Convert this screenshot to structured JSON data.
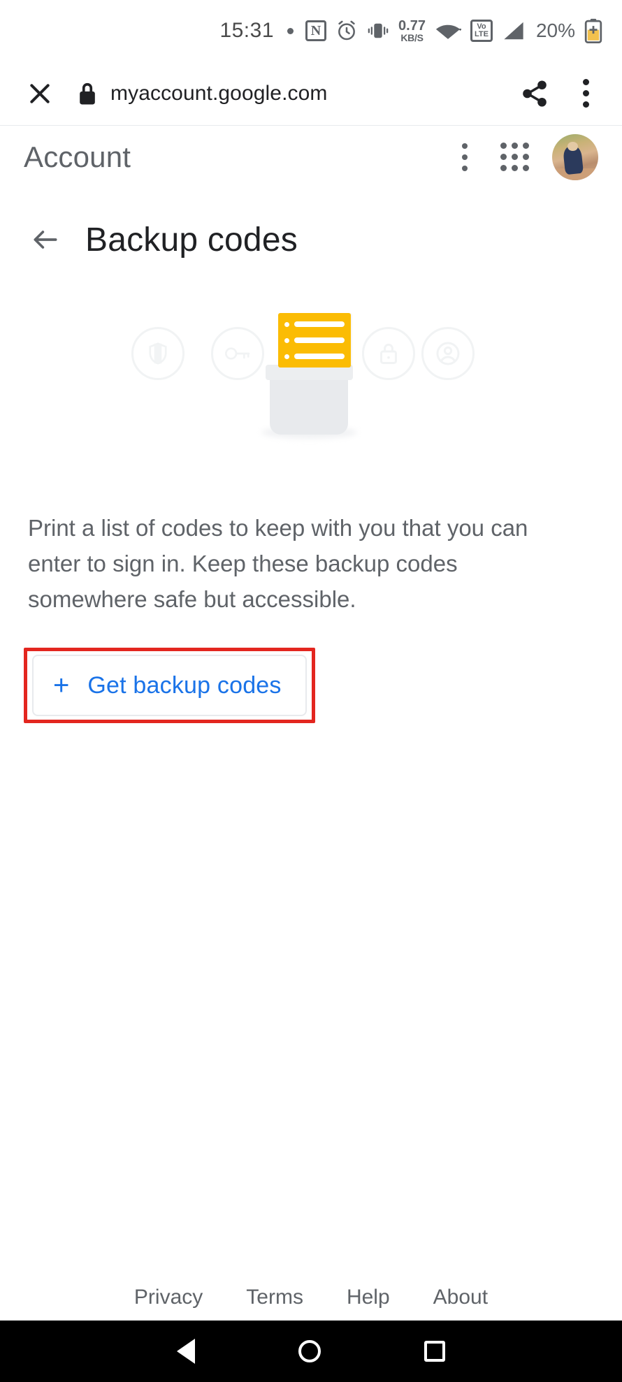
{
  "status_bar": {
    "time": "15:31",
    "dot": "•",
    "nfc_label": "N",
    "data_rate_value": "0.77",
    "data_rate_unit": "KB/S",
    "volte_top": "Vo",
    "volte_bottom": "LTE",
    "battery_percent": "20%",
    "icons": [
      "nfc-icon",
      "alarm-icon",
      "vibrate-icon",
      "data-rate-icon",
      "wifi-icon",
      "volte-icon",
      "signal-icon",
      "battery-icon"
    ]
  },
  "browser_bar": {
    "close_icon": "close-icon",
    "lock_icon": "lock-icon",
    "url": "myaccount.google.com",
    "share_icon": "share-icon",
    "more_icon": "more-vertical-icon"
  },
  "account_header": {
    "title": "Account",
    "more_icon": "more-vertical-icon",
    "apps_icon": "apps-grid-icon",
    "avatar": "user-avatar"
  },
  "page": {
    "back_icon": "back-arrow-icon",
    "title": "Backup codes",
    "body_text": "Print a list of codes to keep with you that you can enter to sign in. Keep these backup codes somewhere safe but accessible.",
    "illustration": {
      "icons": [
        "shield-icon",
        "key-icon",
        "backup-codes-card",
        "lock-icon",
        "person-icon"
      ],
      "card_color": "#fbbc04",
      "printer_color": "#e8eaed",
      "list_rows": 3
    },
    "get_button": {
      "plus": "+",
      "label": "Get backup codes",
      "text_color": "#1a73e8"
    },
    "annotation": {
      "color": "#e3261f",
      "target": "get-backup-codes-button"
    }
  },
  "footer": {
    "links": [
      {
        "label": "Privacy"
      },
      {
        "label": "Terms"
      },
      {
        "label": "Help"
      },
      {
        "label": "About"
      }
    ]
  },
  "nav_bar": {
    "back": "nav-back-icon",
    "home": "nav-home-icon",
    "recents": "nav-recents-icon"
  }
}
